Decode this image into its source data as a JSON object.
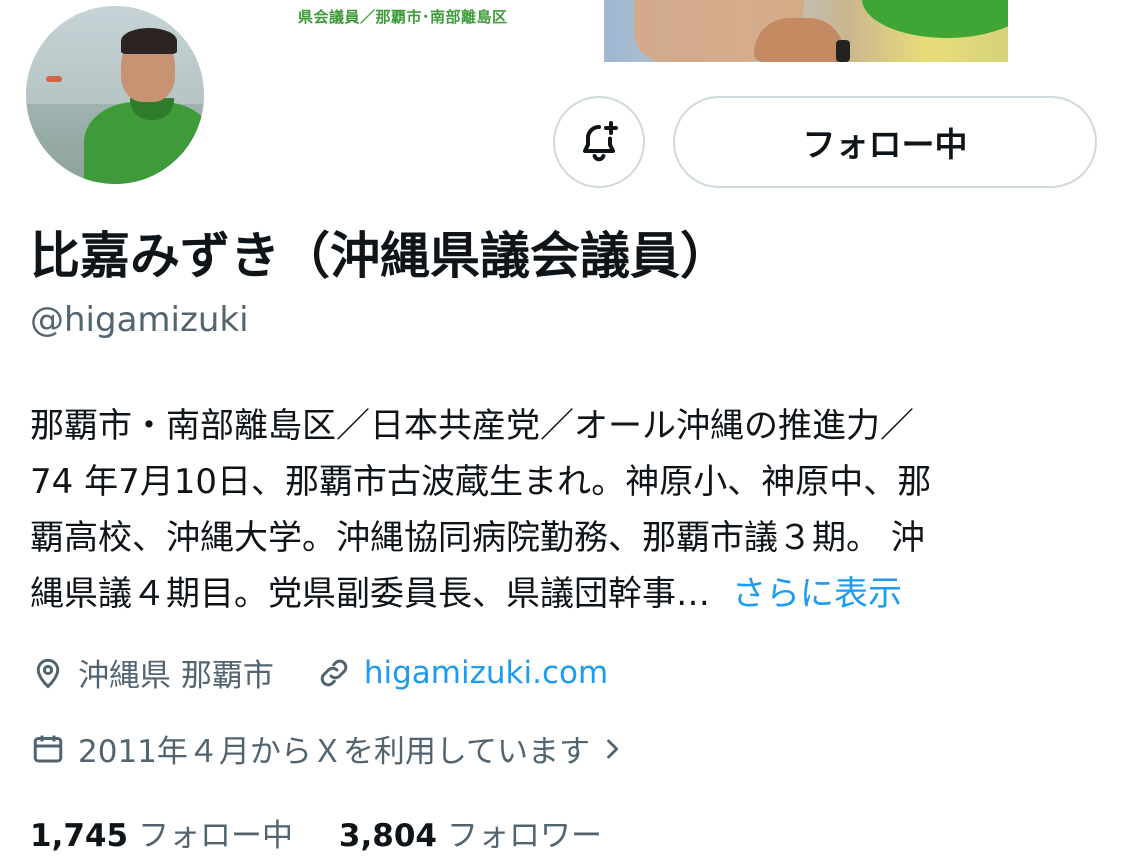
{
  "banner": {
    "text": "県会議員／那覇市･南部離島区"
  },
  "buttons": {
    "notify_icon": "bell-plus-icon",
    "follow_label": "フォロー中"
  },
  "profile": {
    "display_name": "比嘉みずき（沖縄県議会議員）",
    "handle": "@higamizuki",
    "bio_lines": [
      "那覇市・南部離島区／日本共産党／オール沖縄の推進力／",
      "74 年7月10日、那覇市古波蔵生まれ。神原小、神原中、那",
      "覇高校、沖縄大学。沖縄協同病院勤務、那覇市議３期。 沖",
      "縄県議４期目。党県副委員長、県議団幹事…"
    ],
    "bio_more": "さらに表示",
    "location": "沖縄県 那覇市",
    "website": "higamizuki.com",
    "joined": "2011年４月からＸを利用しています",
    "following_count": "1,745",
    "following_label": "フォロー中",
    "followers_count": "3,804",
    "followers_label": "フォロワー"
  },
  "icons": {
    "location": "location-pin-icon",
    "link": "link-icon",
    "calendar": "calendar-icon",
    "chevron": "chevron-right-icon"
  },
  "colors": {
    "link": "#1d9bf0",
    "secondary_text": "#536471",
    "primary_text": "#0f1419",
    "border": "#cfd9de",
    "banner_green": "#3f9b3a"
  }
}
